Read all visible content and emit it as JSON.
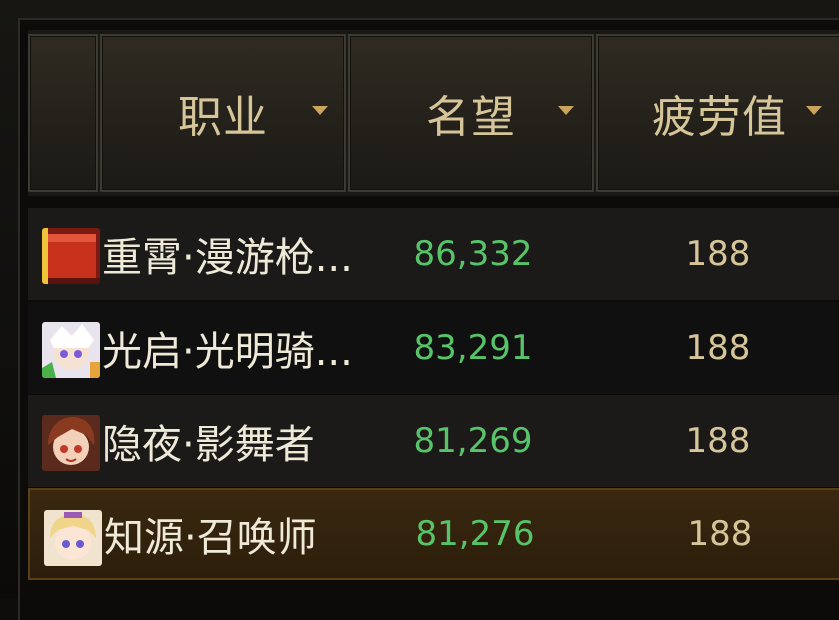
{
  "header": {
    "columns": [
      {
        "label": "",
        "sort_icon": "none"
      },
      {
        "label": "职业",
        "sort_icon": "sort-down-icon"
      },
      {
        "label": "名望",
        "sort_icon": "sort-down-icon"
      },
      {
        "label": "疲劳值",
        "sort_icon": "sort-down-icon"
      }
    ]
  },
  "rows": [
    {
      "avatar": "class-icon-red-banner",
      "job": "重霄·漫游枪...",
      "fame": "86,332",
      "fatigue": "188",
      "selected": false
    },
    {
      "avatar": "class-icon-white-hair-character",
      "job": "光启·光明骑...",
      "fame": "83,291",
      "fatigue": "188",
      "selected": false
    },
    {
      "avatar": "class-icon-brown-hair-character",
      "job": "隐夜·影舞者",
      "fame": "81,269",
      "fatigue": "188",
      "selected": false
    },
    {
      "avatar": "class-icon-blonde-character",
      "job": "知源·召唤师",
      "fame": "81,276",
      "fatigue": "188",
      "selected": true
    }
  ],
  "colors": {
    "header_text": "#d7c59a",
    "fame_text": "#58c46a",
    "job_text": "#efe9d8",
    "selected_row": "#3a2810"
  }
}
